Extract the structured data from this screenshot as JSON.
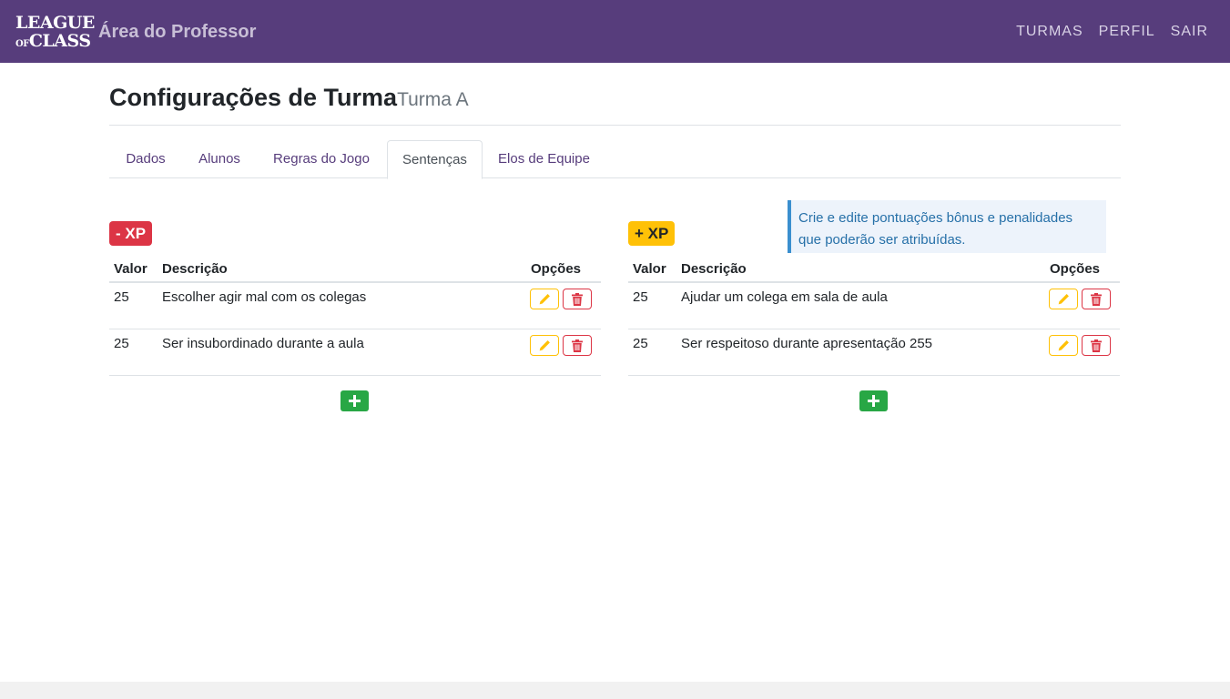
{
  "header": {
    "logo_line1": "LEAGUE",
    "logo_of": "OF",
    "logo_line2": "CLASS",
    "brand_title": "Área do Professor",
    "nav": [
      "TURMAS",
      "PERFIL",
      "SAIR"
    ]
  },
  "page": {
    "title": "Configurações de Turma",
    "subtitle": "Turma A"
  },
  "tabs": [
    "Dados",
    "Alunos",
    "Regras do Jogo",
    "Sentenças",
    "Elos de Equipe"
  ],
  "active_tab": "Sentenças",
  "info": "Crie e edite pontuações bônus e penalidades que poderão ser atribuídas.",
  "columns": {
    "valor": "Valor",
    "descricao": "Descrição",
    "opcoes": "Opções"
  },
  "minus_xp": {
    "badge": "- XP",
    "rows": [
      {
        "valor": "25",
        "descricao": "Escolher agir mal com os colegas"
      },
      {
        "valor": "25",
        "descricao": "Ser insubordinado durante a aula"
      }
    ]
  },
  "plus_xp": {
    "badge": "+ XP",
    "rows": [
      {
        "valor": "25",
        "descricao": "Ajudar um colega em sala de aula"
      },
      {
        "valor": "25",
        "descricao": "Ser respeitoso durante apresentação 255"
      }
    ]
  },
  "icons": {
    "edit": "pencil-icon",
    "delete": "trash-icon",
    "add": "plus-icon"
  },
  "colors": {
    "navbar": "#573d7c",
    "danger": "#dc3545",
    "warning": "#ffc107",
    "success": "#28a745",
    "info_border": "#3a8fcf"
  }
}
